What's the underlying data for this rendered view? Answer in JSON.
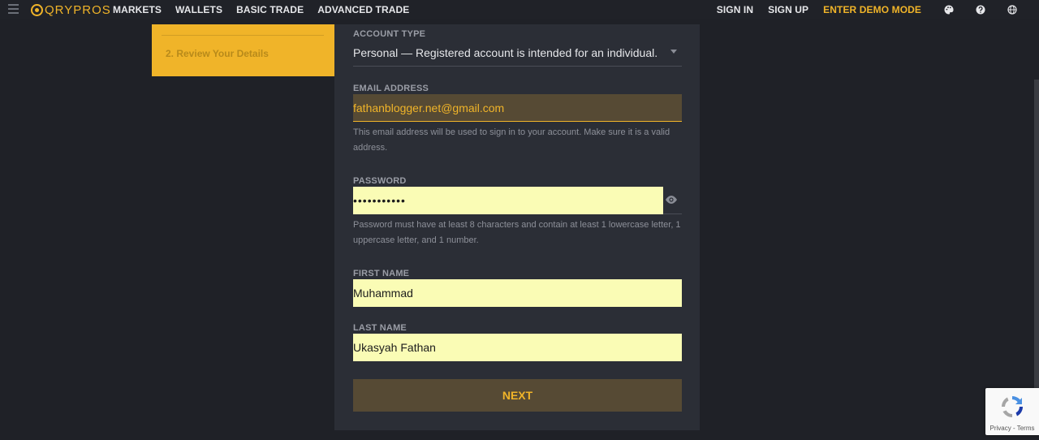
{
  "nav": {
    "logo_text": "QRYPROS",
    "left_links": [
      "MARKETS",
      "WALLETS",
      "BASIC TRADE",
      "ADVANCED TRADE"
    ],
    "sign_in": "SIGN IN",
    "sign_up": "SIGN UP",
    "demo_mode": "ENTER DEMO MODE",
    "icons": [
      "palette-icon",
      "help-icon",
      "globe-icon"
    ]
  },
  "stepper": {
    "step_label": "2. Review Your Details"
  },
  "form": {
    "account_type": {
      "label": "ACCOUNT TYPE",
      "value": "Personal — Registered account is intended for an individual."
    },
    "email": {
      "label": "EMAIL ADDRESS",
      "value": "fathanblogger.net@gmail.com",
      "help": "This email address will be used to sign in to your account. Make sure it is a valid address."
    },
    "password": {
      "label": "PASSWORD",
      "value": "•••••••••••",
      "help": "Password must have at least 8 characters and contain at least 1 lowercase letter, 1 uppercase letter, and 1 number."
    },
    "first_name": {
      "label": "FIRST NAME",
      "value": "Muhammad"
    },
    "last_name": {
      "label": "LAST NAME",
      "value": "Ukasyah Fathan"
    },
    "next_label": "NEXT"
  },
  "recaptcha": {
    "links": "Privacy - Terms"
  },
  "colors": {
    "accent": "#f0b429",
    "background": "#1f2127",
    "card": "#2b2e36",
    "autofill": "#fafcb5"
  }
}
